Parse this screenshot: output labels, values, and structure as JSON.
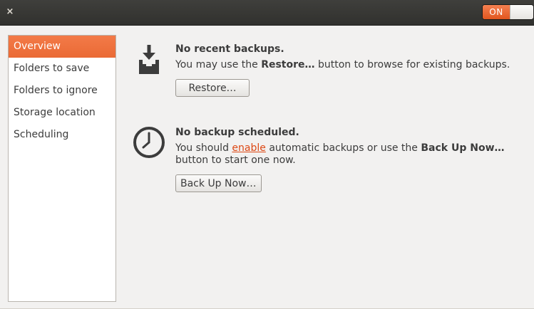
{
  "titlebar": {
    "close_glyph": "×",
    "close_icon": "close-icon",
    "switch_label": "ON",
    "switch_state": "on"
  },
  "sidebar": {
    "items": [
      {
        "label": "Overview",
        "selected": true
      },
      {
        "label": "Folders to save",
        "selected": false
      },
      {
        "label": "Folders to ignore",
        "selected": false
      },
      {
        "label": "Storage location",
        "selected": false
      },
      {
        "label": "Scheduling",
        "selected": false
      }
    ]
  },
  "restore": {
    "icon": "download-tray-icon",
    "title": "No recent backups.",
    "body_prefix": "You may use the ",
    "body_bold": "Restore…",
    "body_suffix": " button to browse for existing backups.",
    "button_label": "Restore…"
  },
  "schedule": {
    "icon": "clock-icon",
    "title": "No backup scheduled.",
    "body_prefix": "You should ",
    "link_text": "enable",
    "body_middle": " automatic backups or use the ",
    "body_bold": "Back Up Now…",
    "body_suffix": " button to start one now.",
    "button_label": "Back Up Now…"
  },
  "colors": {
    "accent": "#ea6a35",
    "link": "#dd4814",
    "titlebar": "#3c3b37",
    "background": "#f2f1f0"
  }
}
